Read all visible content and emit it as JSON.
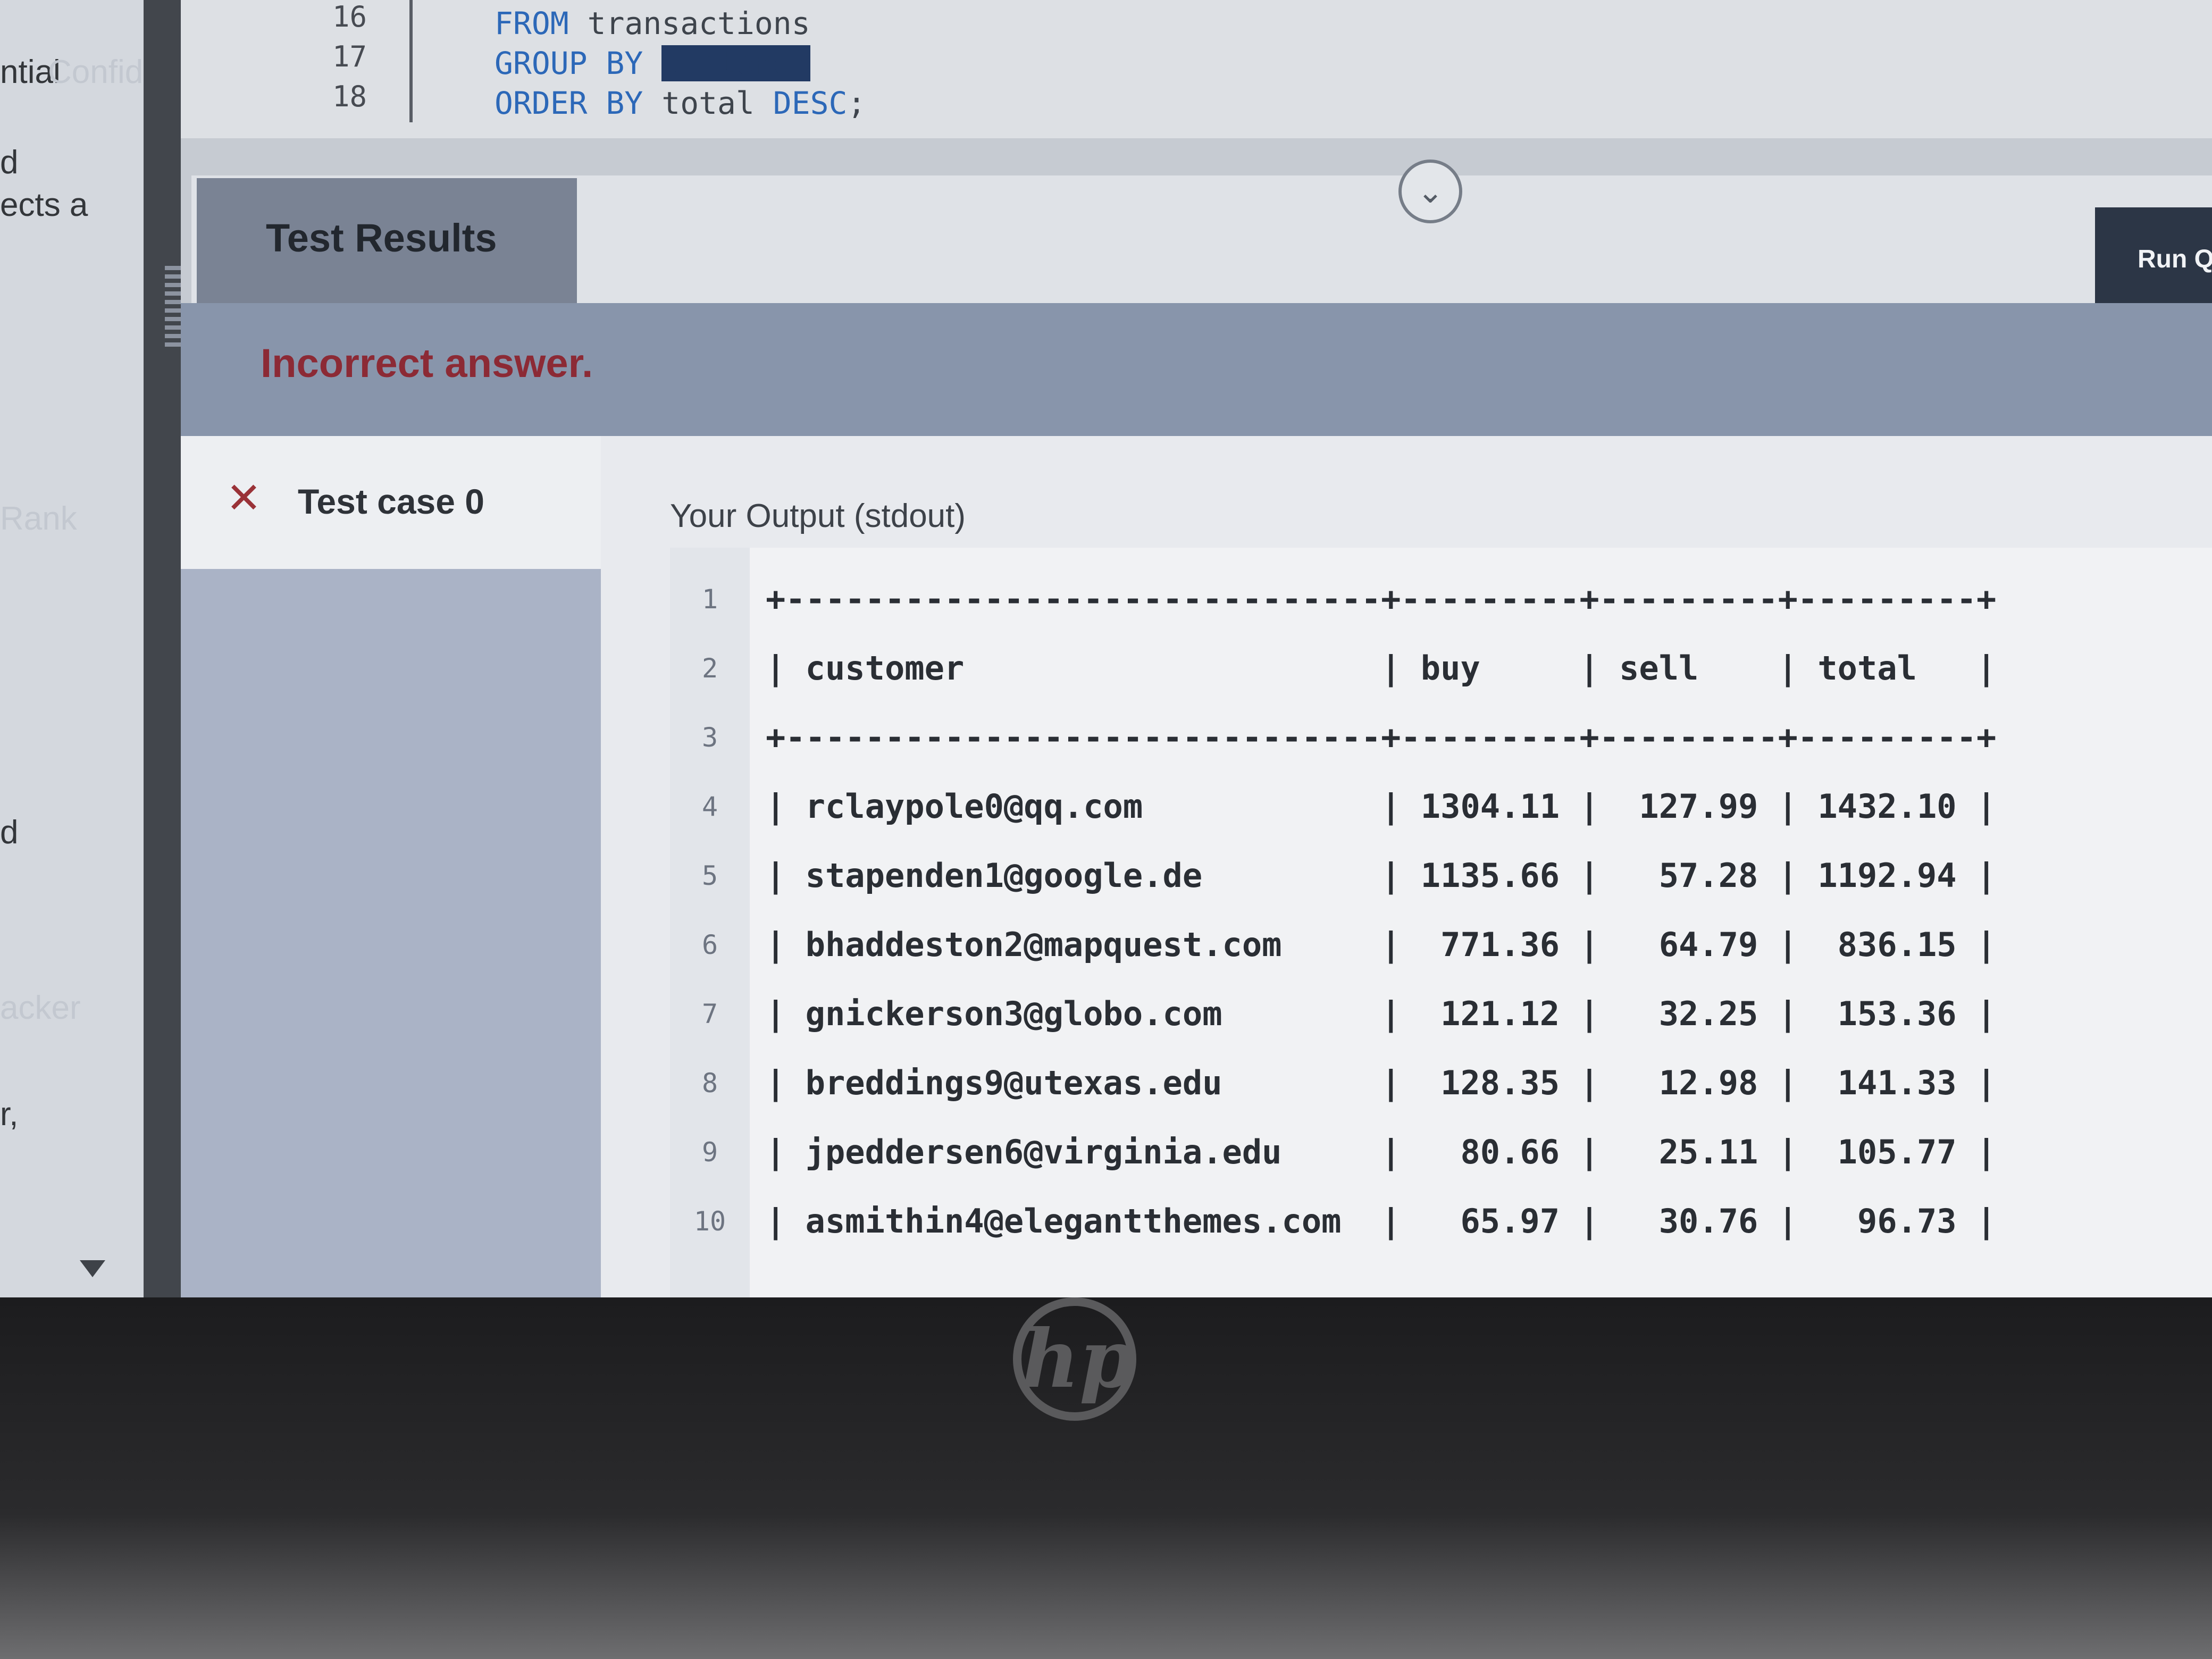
{
  "sidebar_fragments": [
    "ntial",
    "Confiden",
    "d",
    "ects a",
    "Rank",
    "d",
    "acker",
    "r,"
  ],
  "editor": {
    "lines": [
      {
        "num": "16",
        "kw": "FROM",
        "rest": " transactions"
      },
      {
        "num": "17",
        "kw": "GROUP BY",
        "rest": ""
      },
      {
        "num": "18",
        "kw": "ORDER BY",
        "rest": " total ",
        "kw2": "DESC",
        "tail": ";"
      }
    ]
  },
  "results": {
    "tab_label": "Test Results",
    "collapse_icon": "chevron-down-icon",
    "run_label": "Run Q",
    "status": "Incorrect answer.",
    "status_color": "#8c2a35",
    "test_case": {
      "icon": "close-icon",
      "label": "Test case 0"
    },
    "output_label": "Your Output (stdout)"
  },
  "output": {
    "line_numbers": [
      "1",
      "2",
      "3",
      "4",
      "5",
      "6",
      "7",
      "8",
      "9",
      "10"
    ],
    "separator": "+------------------------------+---------+---------+---------+",
    "headers": [
      "customer",
      "buy",
      "sell",
      "total"
    ],
    "rows": [
      [
        "rclaypole0@qq.com",
        "1304.11",
        "127.99",
        "1432.10"
      ],
      [
        "stapenden1@google.de",
        "1135.66",
        "57.28",
        "1192.94"
      ],
      [
        "bhaddeston2@mapquest.com",
        "771.36",
        "64.79",
        "836.15"
      ],
      [
        "gnickerson3@globo.com",
        "121.12",
        "32.25",
        "153.36"
      ],
      [
        "breddings9@utexas.edu",
        "128.35",
        "12.98",
        "141.33"
      ],
      [
        "jpeddersen6@virginia.edu",
        "80.66",
        "25.11",
        "105.77"
      ],
      [
        "asmithin4@elegantthemes.com",
        "65.97",
        "30.76",
        "96.73"
      ]
    ]
  },
  "device": {
    "logo": "hp"
  }
}
